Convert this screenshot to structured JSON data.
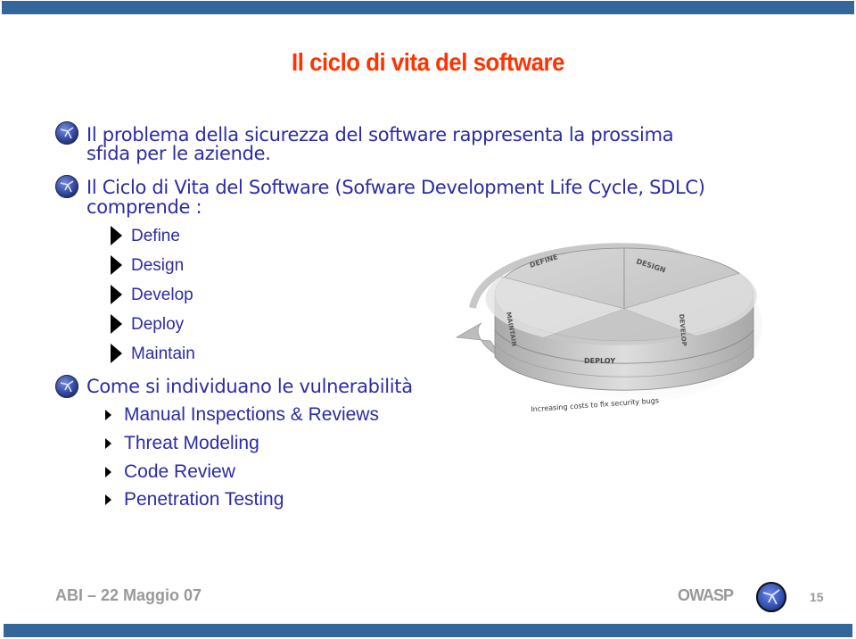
{
  "slide": {
    "title": "Il ciclo di vita del software",
    "bullets": [
      {
        "icon": "owasp-logo-icon",
        "line1": "Il problema della sicurezza del software rappresenta la prossima",
        "line2": "sfida per le aziende."
      },
      {
        "icon": "owasp-logo-icon",
        "line1": "Il Ciclo di Vita del Software (Sofware Development Life Cycle, SDLC)",
        "line2": "comprende :",
        "sub_items": [
          "Define",
          "Design",
          "Develop",
          "Deploy",
          "Maintain"
        ]
      },
      {
        "icon": "owasp-logo-icon",
        "line1": "Come si individuano le vulnerabilità",
        "sub_items": [
          "Manual Inspections & Reviews",
          "Threat Modeling",
          "Code Review",
          "Penetration Testing"
        ]
      }
    ],
    "diagram": {
      "segments": [
        "DEFINE",
        "DESIGN",
        "DEVELOP",
        "DEPLOY",
        "MAINTAIN"
      ],
      "caption": "Increasing costs to fix security bugs"
    }
  },
  "footer": {
    "left": "ABI – 22 Maggio 07",
    "brand": "OWASP",
    "page_number": "15"
  },
  "colors": {
    "band": "#336699",
    "title": "#ff3300",
    "body_text": "#2b2ba8",
    "footer_text": "#999999"
  }
}
